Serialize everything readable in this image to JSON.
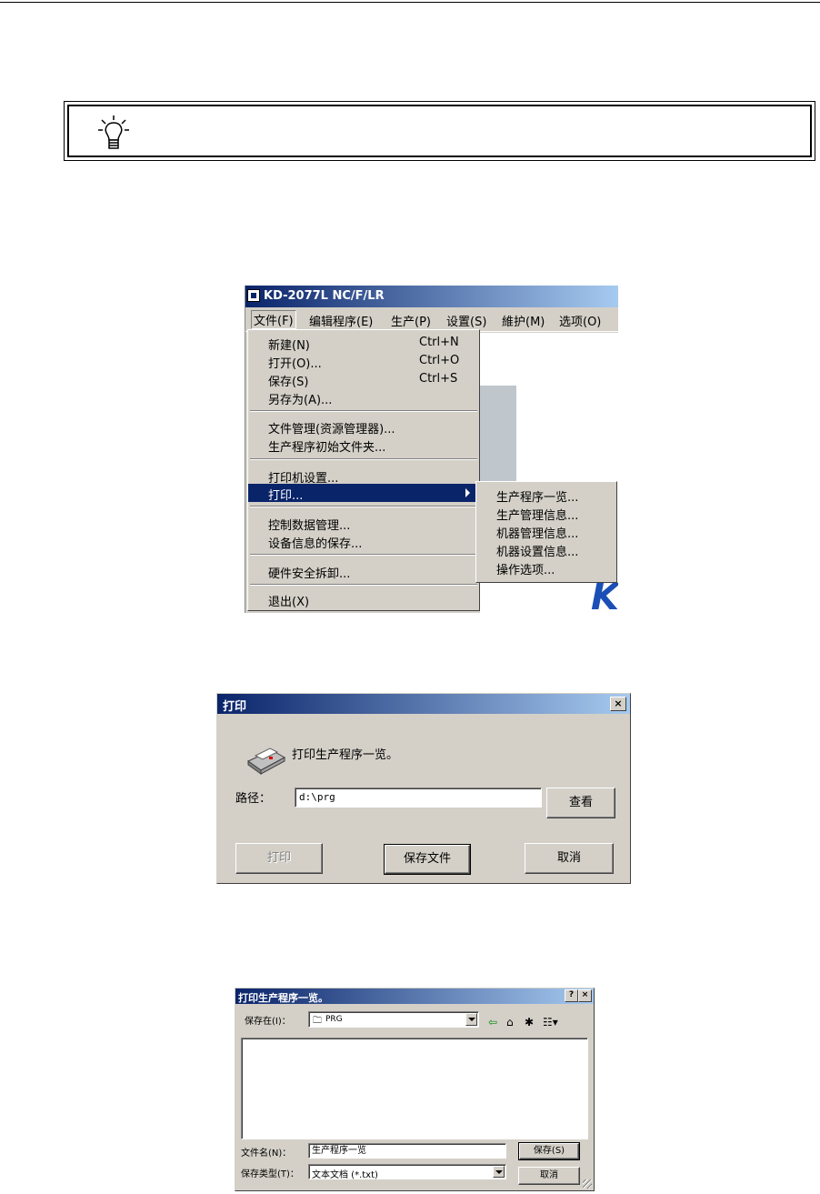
{
  "menu_window": {
    "title": "KD-2077L NC/F/LR",
    "menubar": [
      "文件(F)",
      "编辑程序(E)",
      "生产(P)",
      "设置(S)",
      "維护(M)",
      "选项(O)"
    ],
    "file_menu": [
      {
        "label": "新建(N)",
        "shortcut": "Ctrl+N"
      },
      {
        "label": "打开(O)...",
        "shortcut": "Ctrl+O"
      },
      {
        "label": "保存(S)",
        "shortcut": "Ctrl+S"
      },
      {
        "label": "另存为(A)..."
      },
      {
        "label": "文件管理(资源管理器)..."
      },
      {
        "label": "生产程序初始文件夹..."
      },
      {
        "label": "打印机设置..."
      },
      {
        "label": "打印...",
        "highlighted": true
      },
      {
        "label": "控制数据管理..."
      },
      {
        "label": "设备信息的保存..."
      },
      {
        "label": "硬件安全拆卸..."
      },
      {
        "label": "退出(X)"
      }
    ],
    "print_submenu": [
      "生产程序一览...",
      "生产管理信息...",
      "机器管理信息...",
      "机器设置信息...",
      "操作选项..."
    ]
  },
  "print_dialog": {
    "title": "打印",
    "close": "×",
    "message": "打印生产程序一览。",
    "path_label": "路径：",
    "path_value": "d:\\prg",
    "browse_button": "查看",
    "print_button": "打印",
    "save_button": "保存文件",
    "cancel_button": "取消"
  },
  "save_dialog": {
    "title": "打印生产程序一览。",
    "help": "?",
    "close": "×",
    "save_in_label": "保存在(I)：",
    "save_in_value": "PRG",
    "filename_label": "文件名(N)：",
    "filename_value": "生产程序一览",
    "filetype_label": "保存类型(T)：",
    "filetype_value": "文本文档 (*.txt)",
    "save_button": "保存(S)",
    "cancel_button": "取消"
  },
  "colors": {
    "titlebar": "#0a246a",
    "titlebar_end": "#a6caf0",
    "face": "#d4d0c8",
    "highlight": "#0a246a"
  }
}
